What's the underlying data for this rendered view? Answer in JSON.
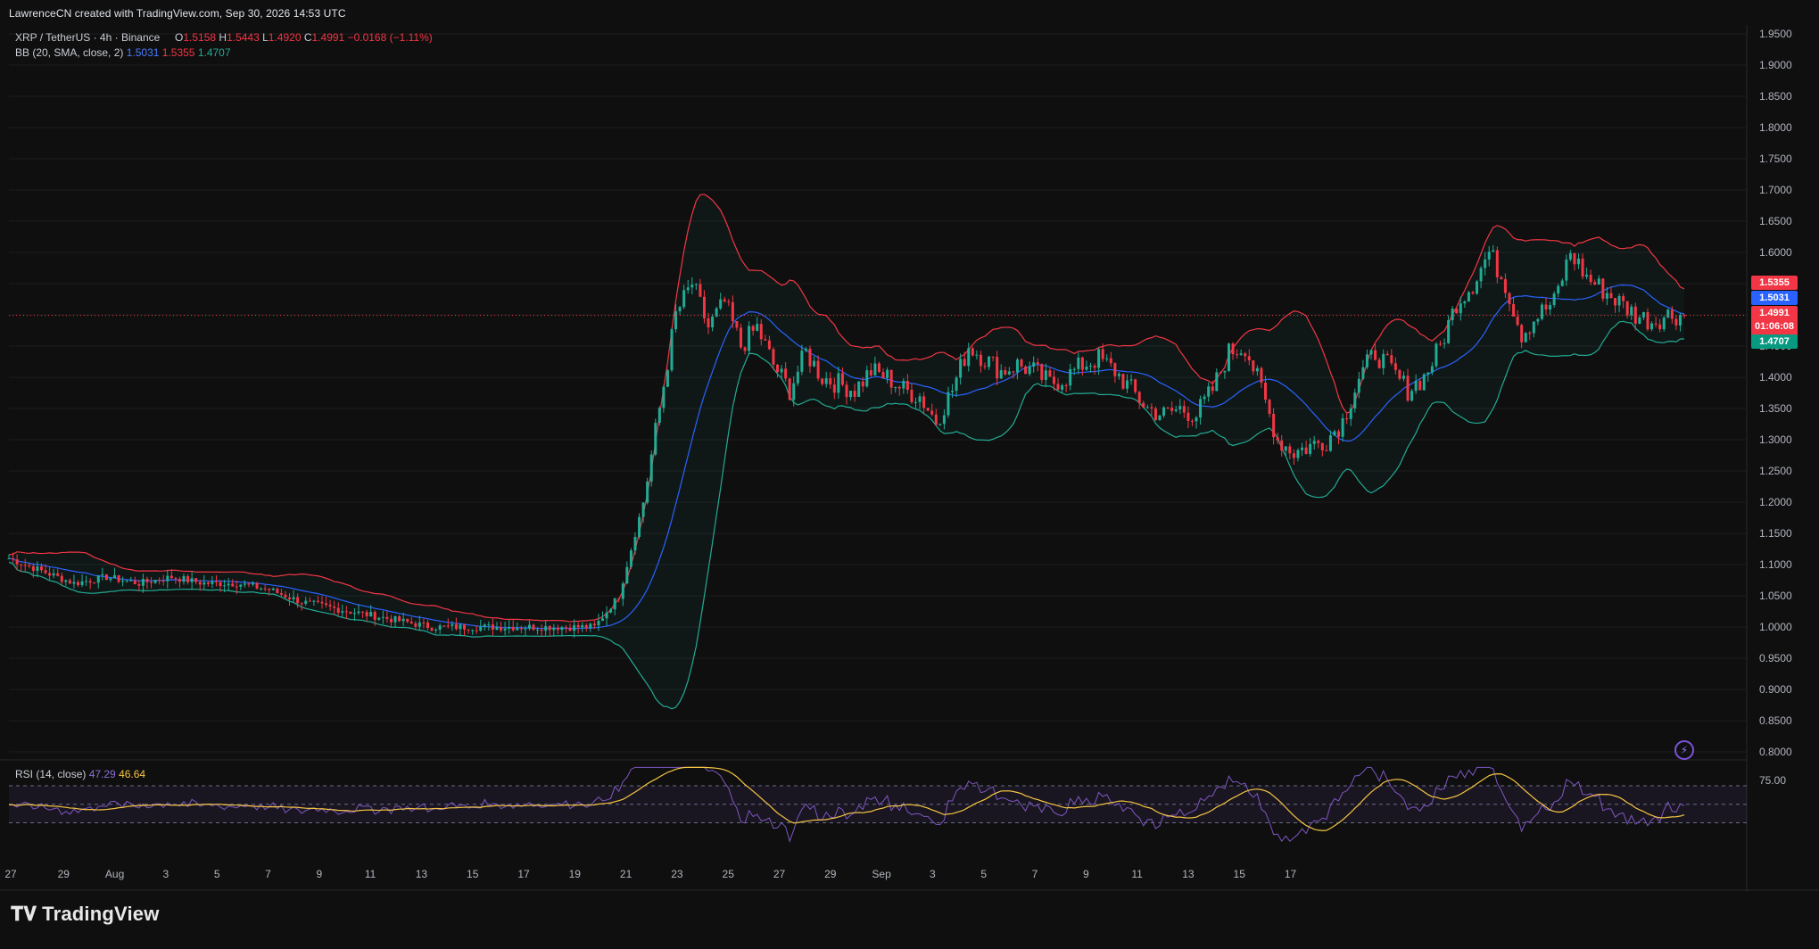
{
  "header": {
    "created_line": "LawrenceCN created with TradingView.com, Sep 30, 2026 14:53 UTC"
  },
  "legend": {
    "symbol": "XRP / TetherUS · 4h · Binance",
    "o_label": "O",
    "o_value": "1.5158",
    "h_label": "H",
    "h_value": "1.5443",
    "l_label": "L",
    "l_value": "1.4920",
    "c_label": "C",
    "c_value": "1.4991",
    "change": "−0.0168 (−1.11%)",
    "bb_label": "BB (20, SMA, close, 2)",
    "bb_basis": "1.5031",
    "bb_upper": "1.5355",
    "bb_lower": "1.4707",
    "rsi_label": "RSI (14, close)",
    "rsi_value": "47.29",
    "rsi_ma": "46.64"
  },
  "price_tags": {
    "upper": "1.5355",
    "basis": "1.5031",
    "last": "1.4991",
    "countdown": "01:06:08",
    "lower": "1.4707"
  },
  "rsi_axis_label": "75.00",
  "brand": "TradingView",
  "colors": {
    "background": "#0f0f0f",
    "up": "#22ab94",
    "down": "#f23645",
    "bb_basis": "#2962ff",
    "bb_upper": "#f23645",
    "bb_lower": "#22ab94",
    "rsi": "#7e57c2",
    "rsi_ma": "#f5c542"
  },
  "chart_data": {
    "type": "candlestick",
    "symbol": "XRP / TetherUS",
    "timeframe": "4h",
    "exchange": "Binance",
    "y_axis": {
      "ticks": [
        "1.9500",
        "1.9000",
        "1.8500",
        "1.8000",
        "1.7500",
        "1.7000",
        "1.6500",
        "1.6000",
        "1.5500",
        "1.5000",
        "1.4500",
        "1.4000",
        "1.3500",
        "1.3000",
        "1.2500",
        "1.2000",
        "1.1500",
        "1.1000",
        "1.0500",
        "1.0000",
        "0.9500",
        "0.9000",
        "0.8500",
        "0.8000"
      ],
      "range": [
        0.8,
        1.95
      ]
    },
    "x_axis": {
      "ticks": [
        "27",
        "29",
        "Aug",
        "3",
        "5",
        "7",
        "9",
        "11",
        "13",
        "15",
        "17",
        "19",
        "21",
        "23",
        "25",
        "27",
        "29",
        "Sep",
        "3",
        "5",
        "7",
        "9",
        "11",
        "13",
        "15",
        "17"
      ]
    },
    "series": [
      {
        "name": "XRP / TetherUS",
        "kind": "candles",
        "close_path": [
          [
            0,
            1.11
          ],
          [
            8,
            1.09
          ],
          [
            16,
            1.07
          ],
          [
            24,
            1.08
          ],
          [
            32,
            1.07
          ],
          [
            40,
            1.08
          ],
          [
            48,
            1.07
          ],
          [
            56,
            1.07
          ],
          [
            64,
            1.06
          ],
          [
            72,
            1.04
          ],
          [
            80,
            1.03
          ],
          [
            88,
            1.02
          ],
          [
            96,
            1.01
          ],
          [
            104,
            1.0
          ],
          [
            112,
            1.0
          ],
          [
            120,
            1.0
          ],
          [
            128,
            1.0
          ],
          [
            136,
            1.0
          ],
          [
            144,
            1.0
          ],
          [
            150,
            1.05
          ],
          [
            156,
            1.2
          ],
          [
            160,
            1.35
          ],
          [
            164,
            1.5
          ],
          [
            168,
            1.55
          ],
          [
            172,
            1.48
          ],
          [
            176,
            1.52
          ],
          [
            180,
            1.45
          ],
          [
            184,
            1.48
          ],
          [
            188,
            1.42
          ],
          [
            192,
            1.38
          ],
          [
            196,
            1.44
          ],
          [
            200,
            1.4
          ],
          [
            204,
            1.39
          ],
          [
            208,
            1.38
          ],
          [
            212,
            1.41
          ],
          [
            216,
            1.4
          ],
          [
            220,
            1.38
          ],
          [
            224,
            1.37
          ],
          [
            228,
            1.33
          ],
          [
            232,
            1.38
          ],
          [
            236,
            1.45
          ],
          [
            240,
            1.43
          ],
          [
            244,
            1.41
          ],
          [
            248,
            1.42
          ],
          [
            252,
            1.41
          ],
          [
            256,
            1.39
          ],
          [
            260,
            1.4
          ],
          [
            264,
            1.42
          ],
          [
            268,
            1.43
          ],
          [
            272,
            1.41
          ],
          [
            276,
            1.38
          ],
          [
            280,
            1.35
          ],
          [
            284,
            1.34
          ],
          [
            288,
            1.35
          ],
          [
            292,
            1.34
          ],
          [
            296,
            1.38
          ],
          [
            300,
            1.44
          ],
          [
            304,
            1.45
          ],
          [
            308,
            1.38
          ],
          [
            312,
            1.3
          ],
          [
            316,
            1.28
          ],
          [
            320,
            1.29
          ],
          [
            324,
            1.3
          ],
          [
            328,
            1.33
          ],
          [
            332,
            1.4
          ],
          [
            336,
            1.44
          ],
          [
            340,
            1.41
          ],
          [
            344,
            1.38
          ],
          [
            348,
            1.4
          ],
          [
            352,
            1.45
          ],
          [
            356,
            1.52
          ],
          [
            360,
            1.55
          ],
          [
            364,
            1.6
          ],
          [
            368,
            1.55
          ],
          [
            372,
            1.47
          ],
          [
            376,
            1.5
          ],
          [
            380,
            1.52
          ],
          [
            384,
            1.6
          ],
          [
            388,
            1.56
          ],
          [
            392,
            1.54
          ],
          [
            396,
            1.52
          ],
          [
            400,
            1.5
          ],
          [
            404,
            1.49
          ],
          [
            408,
            1.5
          ],
          [
            412,
            1.5
          ]
        ]
      },
      {
        "name": "BB basis",
        "value": 1.5031
      },
      {
        "name": "BB upper",
        "value": 1.5355
      },
      {
        "name": "BB lower",
        "value": 1.4707
      },
      {
        "name": "RSI (14, close)",
        "value": 47.29
      },
      {
        "name": "RSI MA",
        "value": 46.64
      }
    ],
    "last_price": 1.4991,
    "rsi_levels": [
      70,
      50,
      30
    ]
  }
}
